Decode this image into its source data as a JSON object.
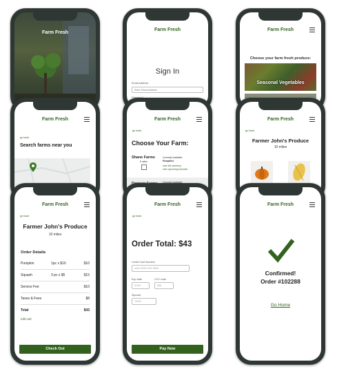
{
  "brand": "Farm Fresh",
  "back": "go back",
  "landing": {
    "title": "Farm Fresh"
  },
  "signin": {
    "title": "Sign In",
    "email_label": "Email Address",
    "email_placeholder": "Enter Email Address",
    "password_label": "Password"
  },
  "produce": {
    "heading": "Choose your farm fresh produce:",
    "banner": "Seasonal Vegetables"
  },
  "search": {
    "heading": "Search farms near you"
  },
  "choose": {
    "title": "Choose Your Farm:",
    "farm1_name": "Shane Farms",
    "farm1_distance": "5 miles",
    "available_label": "Currently Available:",
    "farm1_item": "Pumpkins",
    "link_inventory": "view full inventory",
    "link_upcoming": "view upcoming harvests",
    "farm2_name": "Dannon Farms",
    "farm2_available": "Currently Available:"
  },
  "farmer": {
    "title": "Farmer John's Produce",
    "distance": "10 miles"
  },
  "cart": {
    "title": "Farmer John's Produce",
    "distance": "10 miles",
    "section": "Order Details",
    "rows": [
      {
        "name": "Pumpkin",
        "qty": "1pc x $10",
        "price": "$10"
      },
      {
        "name": "Squash",
        "qty": "3 pc x $5",
        "price": "$15"
      },
      {
        "name": "Service Fee",
        "qty": "",
        "price": "$10"
      },
      {
        "name": "Taxes & Fees",
        "qty": "",
        "price": "$8"
      }
    ],
    "total_label": "Total",
    "total_value": "$43",
    "edit": "edit cart",
    "checkout": "Check Out"
  },
  "payment": {
    "title": "Order Total: $43",
    "cc_label": "Credit Card Number",
    "cc_value": "4444 3333 2222 0000",
    "exp_label": "Exp date",
    "exp_value": "01/02",
    "cvv_label": "CVV code",
    "cvv_value": "555",
    "zip_label": "Zipcode",
    "zip_value": "70432",
    "pay": "Pay Now"
  },
  "confirm": {
    "line1": "Confirmed!",
    "line2": "Order #102288",
    "home": "Go Home"
  },
  "colors": {
    "accent": "#33621f",
    "frame": "#2f3734"
  }
}
